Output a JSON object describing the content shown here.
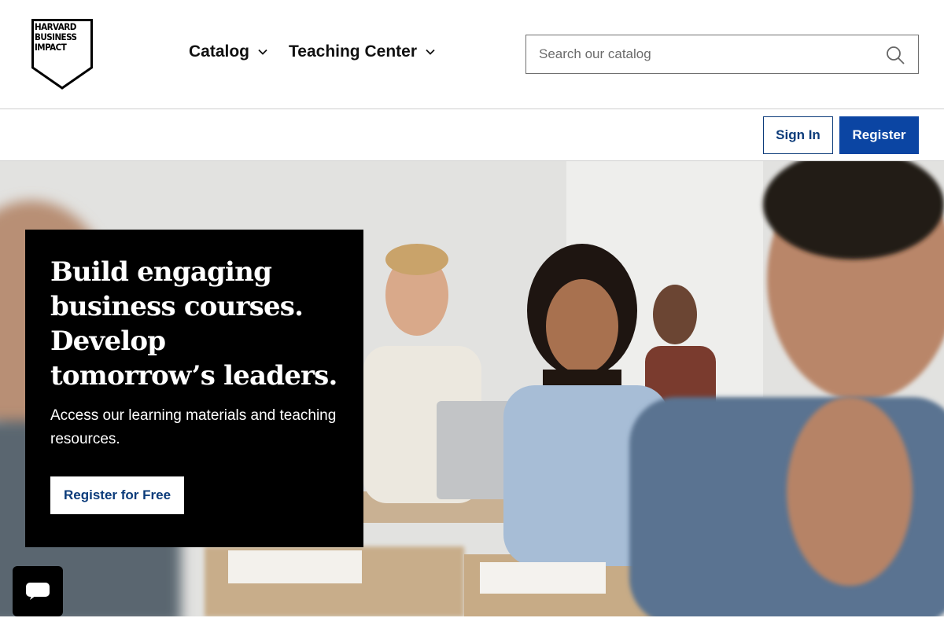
{
  "header": {
    "logo_text": [
      "HARVARD",
      "BUSINESS",
      "IMPACT"
    ],
    "nav": [
      {
        "label": "Catalog"
      },
      {
        "label": "Teaching Center"
      }
    ],
    "search": {
      "placeholder": "Search our catalog",
      "value": ""
    }
  },
  "account": {
    "signin_label": "Sign In",
    "register_label": "Register"
  },
  "hero": {
    "title": "Build engaging business courses. Develop tomorrow’s leaders.",
    "subtitle": "Access our learning materials and teaching resources.",
    "cta_label": "Register for Free"
  },
  "chat": {
    "icon": "chat-bubble-icon"
  },
  "colors": {
    "brand_blue": "#0b45a3",
    "link_blue": "#0b3b7a",
    "card_bg": "#000000",
    "text": "#111111"
  }
}
